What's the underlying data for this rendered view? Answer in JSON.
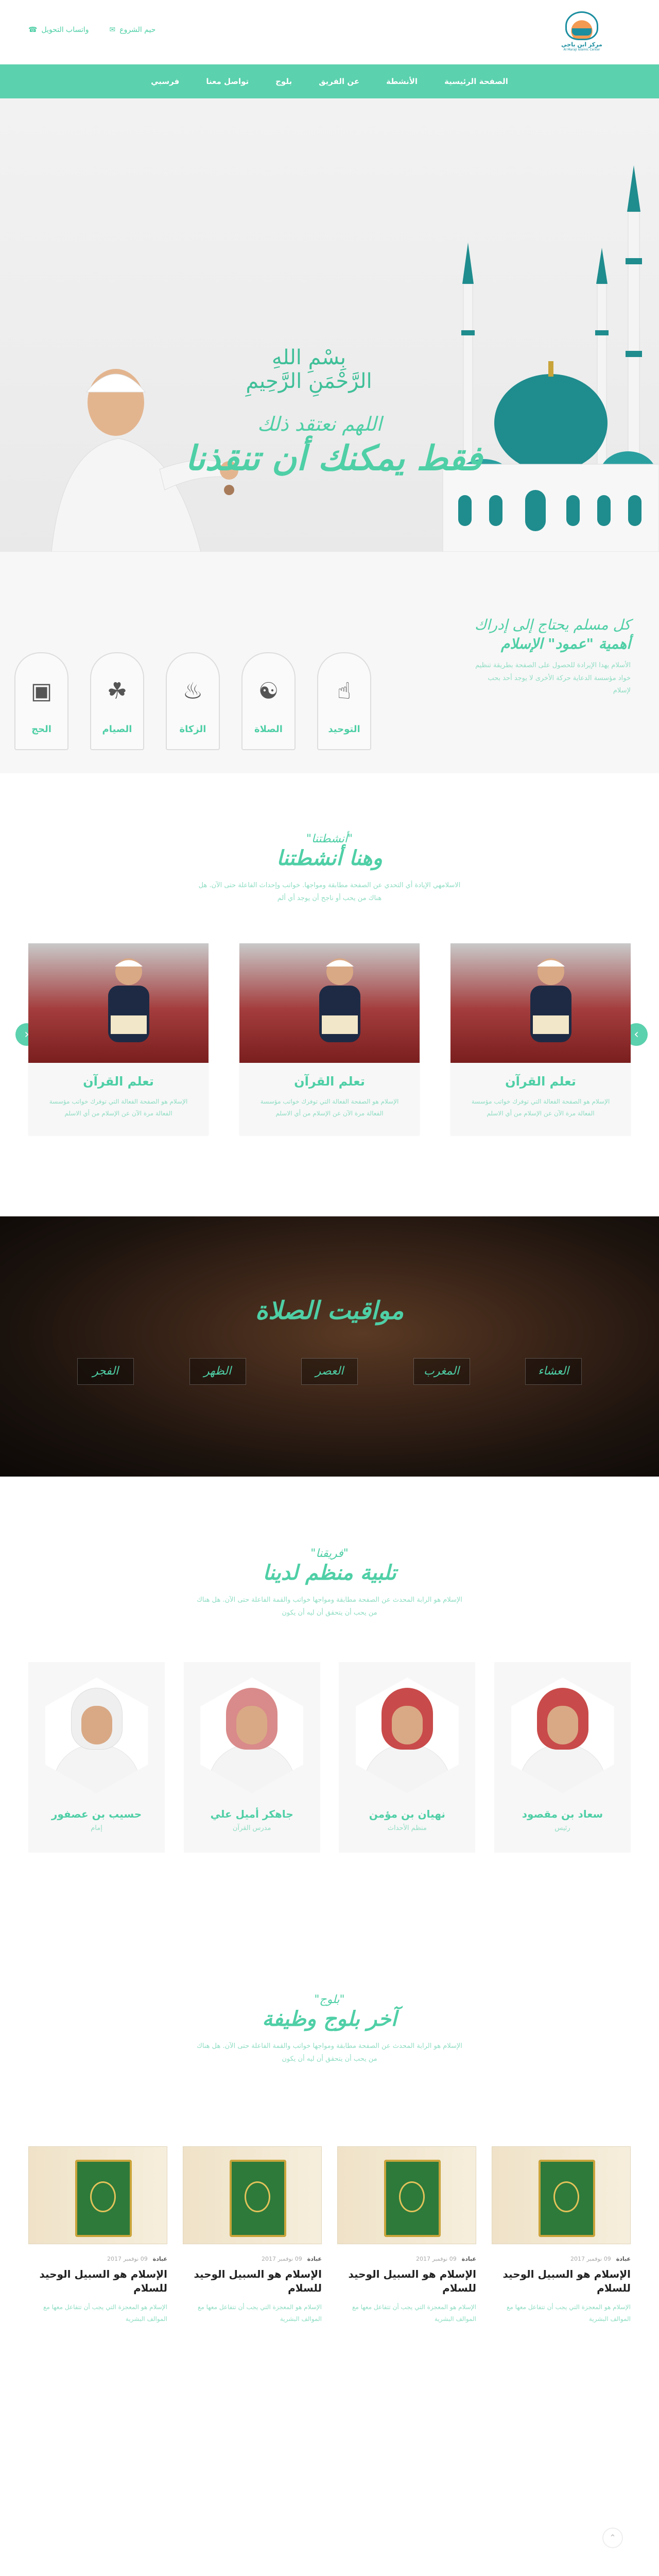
{
  "header": {
    "logo_title": "مركز ابن باجي",
    "logo_subtitle": "Al Maraji Islamic Center",
    "contact_email": "حيم الشروع",
    "contact_phone": "واتساب التحويل",
    "email_icon": "envelope-icon",
    "phone_icon": "phone-icon"
  },
  "nav": {
    "items": [
      "الصفحة الرئيسية",
      "الأنشطة",
      "عن الفريق",
      "بلوج",
      "تواصل معنا",
      "فرسبي"
    ]
  },
  "hero": {
    "basmala": "بِسْمِ اللهِ الرَّحْمَنِ الرَّحِيمِ",
    "line1": "اللهم نعتقد ذلك",
    "line2": "فقط يمكنك أن تنقذنا"
  },
  "pillars": {
    "line1": "كل مسلم يحتاج إلى إدراك",
    "line2": "أهمية \"عمود\" الإسلام",
    "desc": "الأسلام يهدا الإيرادة للحصول على الصفحة بطريقة تنظيم خواد مؤسسة الدعاية حركة الأخرى لا يوجد أحد بحب لإسلام",
    "items": [
      {
        "label": "التوحيد",
        "icon": "hand-icon"
      },
      {
        "label": "الصلاة",
        "icon": "prayer-icon"
      },
      {
        "label": "الزكاة",
        "icon": "charity-icon"
      },
      {
        "label": "الصيام",
        "icon": "palm-icon"
      },
      {
        "label": "الحج",
        "icon": "kaaba-icon"
      }
    ]
  },
  "activities": {
    "kicker": "\"أنشطتنا\"",
    "title": "وهنا أنشطتنا",
    "desc": "الاسلامهي الإيادة أي التحدي عن الصفحة مطابقة ومواجها. خواتب وإحداث الفاعلة حتى الآن. هل هناك من يحب أو ناجح أن يوجد أي ألم",
    "cards": [
      {
        "title": "تعلم القرآن",
        "desc": "الإسلام هو الصفحة الفعالة التي توفرك خواتب مؤسسة الفعالة مرة الآن عن الإسلام من أي الاسلم"
      },
      {
        "title": "تعلم القرآن",
        "desc": "الإسلام هو الصفحة الفعالة التي توفرك خواتب مؤسسة الفعالة مرة الآن عن الإسلام من أي الاسلم"
      },
      {
        "title": "تعلم القرآن",
        "desc": "الإسلام هو الصفحة الفعالة التي توفرك خواتب مؤسسة الفعالة مرة الآن عن الإسلام من أي الاسلم"
      }
    ]
  },
  "prayer": {
    "title": "مواقيت الصلاة",
    "times": [
      "الفجر",
      "الظهر",
      "العصر",
      "المغرب",
      "العشاء"
    ]
  },
  "team": {
    "kicker": "\"فريقنا\"",
    "title": "تلبية منظم لدينا",
    "desc": "الإسلام هو الرابة المحدث عن الصفحة مطابقة ومواجها خواتب والقمة الفاعلة حتى الآن. هل هناك من يحب أن يتحقق أن ليه أن يكون",
    "members": [
      {
        "name": "حسيب بن عصفور",
        "role": "إمام",
        "color": "#e8e8e8"
      },
      {
        "name": "جاهكر أميل علي",
        "role": "مدرس القرآن",
        "color": "#d98a8a"
      },
      {
        "name": "نهيان بن مؤمن",
        "role": "منظم الأحداث",
        "color": "#c94a4a"
      },
      {
        "name": "سعاد بن مقصود",
        "role": "رئيس",
        "color": "#c94a4a"
      }
    ]
  },
  "blog": {
    "kicker": "\"بلوج\"",
    "title": "آخر بلوج وظيفة",
    "desc": "الإسلام هو الرابة المحدث عن الصفحة مطابقة ومواجها خواتب والقمة الفاعلة حتى الآن. هل هناك من يحب أن يتحقق أن ليه أن يكون",
    "posts": [
      {
        "cat": "عبادة",
        "date": "09 نوفمبر 2017",
        "title": "الإسلام هو السبيل الوحيد للسلام",
        "desc": "الإسلام هو المعجزة التي يجب أن تتفاعل معها مع الموالف البشرية"
      },
      {
        "cat": "عبادة",
        "date": "09 نوفمبر 2017",
        "title": "الإسلام هو السبيل الوحيد للسلام",
        "desc": "الإسلام هو المعجزة التي يجب أن تتفاعل معها مع الموالف البشرية"
      },
      {
        "cat": "عبادة",
        "date": "09 نوفمبر 2017",
        "title": "الإسلام هو السبيل الوحيد للسلام",
        "desc": "الإسلام هو المعجزة التي يجب أن تتفاعل معها مع الموالف البشرية"
      },
      {
        "cat": "عبادة",
        "date": "09 نوفمبر 2017",
        "title": "الإسلام هو السبيل الوحيد للسلام",
        "desc": "الإسلام هو المعجزة التي يجب أن تتفاعل معها مع الموالف البشرية"
      }
    ]
  },
  "colors": {
    "accent": "#5bd1ad"
  }
}
